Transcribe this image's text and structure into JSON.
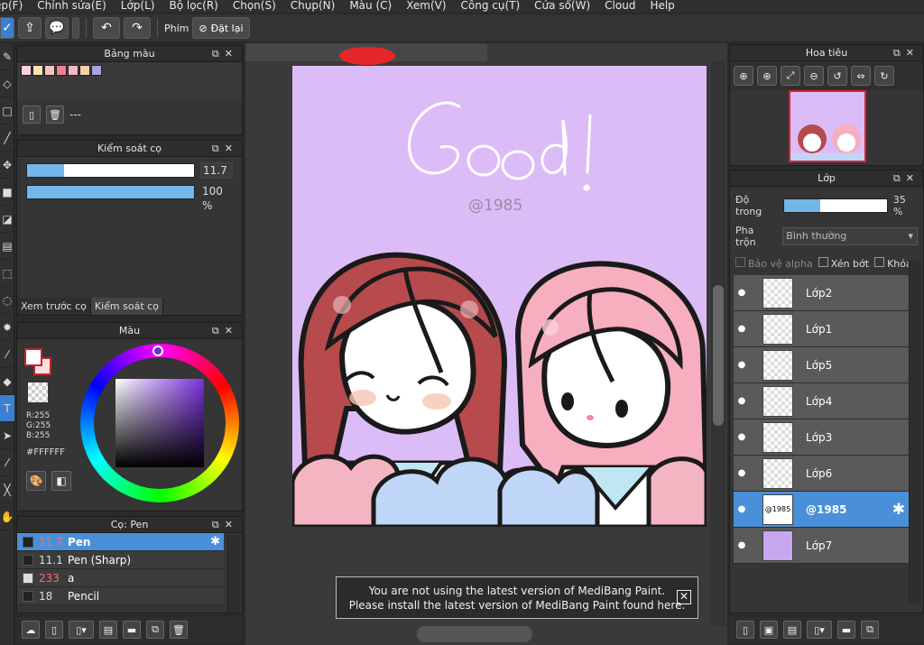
{
  "menu": [
    "ệp(F)",
    "Chỉnh sửa(E)",
    "Lớp(L)",
    "Bộ lọc(R)",
    "Chọn(S)",
    "Chụp(N)",
    "Màu (C)",
    "Xem(V)",
    "Công cụ(T)",
    "Cửa sổ(W)",
    "Cloud",
    "Help"
  ],
  "toolbar": {
    "shortcut_label": "Phím",
    "reset_label": "Đặt lại"
  },
  "palette_panel": {
    "title": "Bảng màu",
    "swatches": [
      "#f7d0d8",
      "#f7e2b0",
      "#f9c3c3",
      "#f07f95",
      "#f4b8c8",
      "#f8cfa9",
      "#a8a4e0"
    ],
    "footer_text": "---"
  },
  "brush_control": {
    "title": "Kiểm soát cọ",
    "size_value": "11.7",
    "size_fraction": 0.22,
    "opacity_value": "100 %",
    "opacity_fraction": 1.0,
    "tab_preview": "Xem trước cọ",
    "tab_control": "Kiểm soát cọ"
  },
  "color_panel": {
    "title": "Màu",
    "r": "R:255",
    "g": "G:255",
    "b": "B:255",
    "hex": "#FFFFFF"
  },
  "brush_panel": {
    "title": "Cọ: Pen",
    "rows": [
      {
        "size": "11.7",
        "name": "Pen",
        "selected": true
      },
      {
        "size": "11.1",
        "name": "Pen (Sharp)",
        "selected": false
      },
      {
        "size": "233",
        "name": "a",
        "selected": false
      },
      {
        "size": "18",
        "name": "Pencil",
        "selected": false
      }
    ]
  },
  "canvas": {
    "watermark": "@1985"
  },
  "notice": {
    "line1": "You are not using the latest version of MediBang Paint.",
    "line2": "Please install the latest version of MediBang Paint found here."
  },
  "navigator": {
    "title": "Hoa tiêu"
  },
  "layer_panel": {
    "title": "Lớp",
    "opacity_label": "Độ trong",
    "opacity_value": "35 %",
    "opacity_fraction": 0.35,
    "blend_label": "Pha trộn",
    "blend_value": "Bình thường",
    "protect_alpha": "Bảo vệ alpha",
    "clipping": "Xén bớt",
    "lock": "Khóa",
    "layers": [
      {
        "name": "Lớp2",
        "selected": false,
        "thumb_text": ""
      },
      {
        "name": "Lớp1",
        "selected": false,
        "thumb_text": ""
      },
      {
        "name": "Lớp5",
        "selected": false,
        "thumb_text": ""
      },
      {
        "name": "Lớp4",
        "selected": false,
        "thumb_text": ""
      },
      {
        "name": "Lớp3",
        "selected": false,
        "thumb_text": ""
      },
      {
        "name": "Lớp6",
        "selected": false,
        "thumb_text": ""
      },
      {
        "name": "@1985",
        "selected": true,
        "thumb_text": "@1985"
      },
      {
        "name": "Lớp7",
        "selected": false,
        "thumb_text": ""
      }
    ]
  }
}
